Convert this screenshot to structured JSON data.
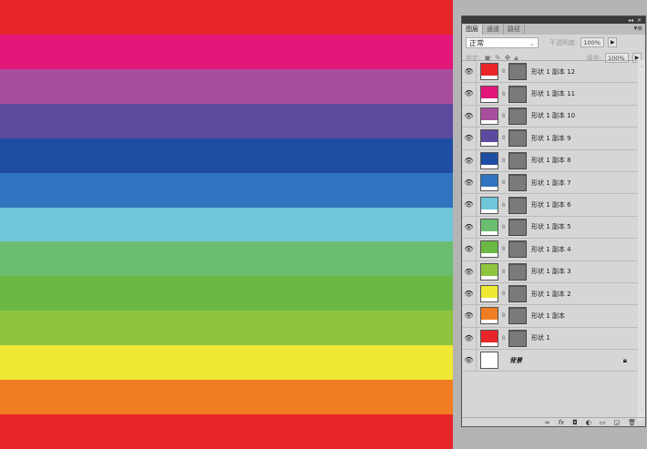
{
  "canvas": {
    "stripes": [
      "#e8262a",
      "#e3177a",
      "#a94e9d",
      "#5c4a9e",
      "#1e4ea1",
      "#2f74bf",
      "#6ec6d8",
      "#6bbd70",
      "#6bb945",
      "#8fc43e",
      "#efe835",
      "#f07d23",
      "#e8262a"
    ]
  },
  "panel": {
    "tabs": [
      "图层",
      "通道",
      "路径"
    ],
    "blend_mode": "正常",
    "opacity_label": "不透明度:",
    "opacity": "100%",
    "lock_label": "锁定:",
    "fill_label": "填充:",
    "fill": "100%",
    "layers": [
      {
        "name": "形状 1 副本 12",
        "color": "#e8262a"
      },
      {
        "name": "形状 1 副本 11",
        "color": "#e3177a"
      },
      {
        "name": "形状 1 副本 10",
        "color": "#a94e9d"
      },
      {
        "name": "形状 1 副本 9",
        "color": "#5c4a9e"
      },
      {
        "name": "形状 1 副本 8",
        "color": "#1e4ea1"
      },
      {
        "name": "形状 1 副本 7",
        "color": "#2f74bf"
      },
      {
        "name": "形状 1 副本 6",
        "color": "#6ec6d8"
      },
      {
        "name": "形状 1 副本 5",
        "color": "#6bbd70"
      },
      {
        "name": "形状 1 副本 4",
        "color": "#6bb945"
      },
      {
        "name": "形状 1 副本 3",
        "color": "#8fc43e"
      },
      {
        "name": "形状 1 副本 2",
        "color": "#efe835"
      },
      {
        "name": "形状 1 副本",
        "color": "#f07d23"
      },
      {
        "name": "形状 1",
        "color": "#e8262a"
      }
    ],
    "background_layer": "背景"
  }
}
